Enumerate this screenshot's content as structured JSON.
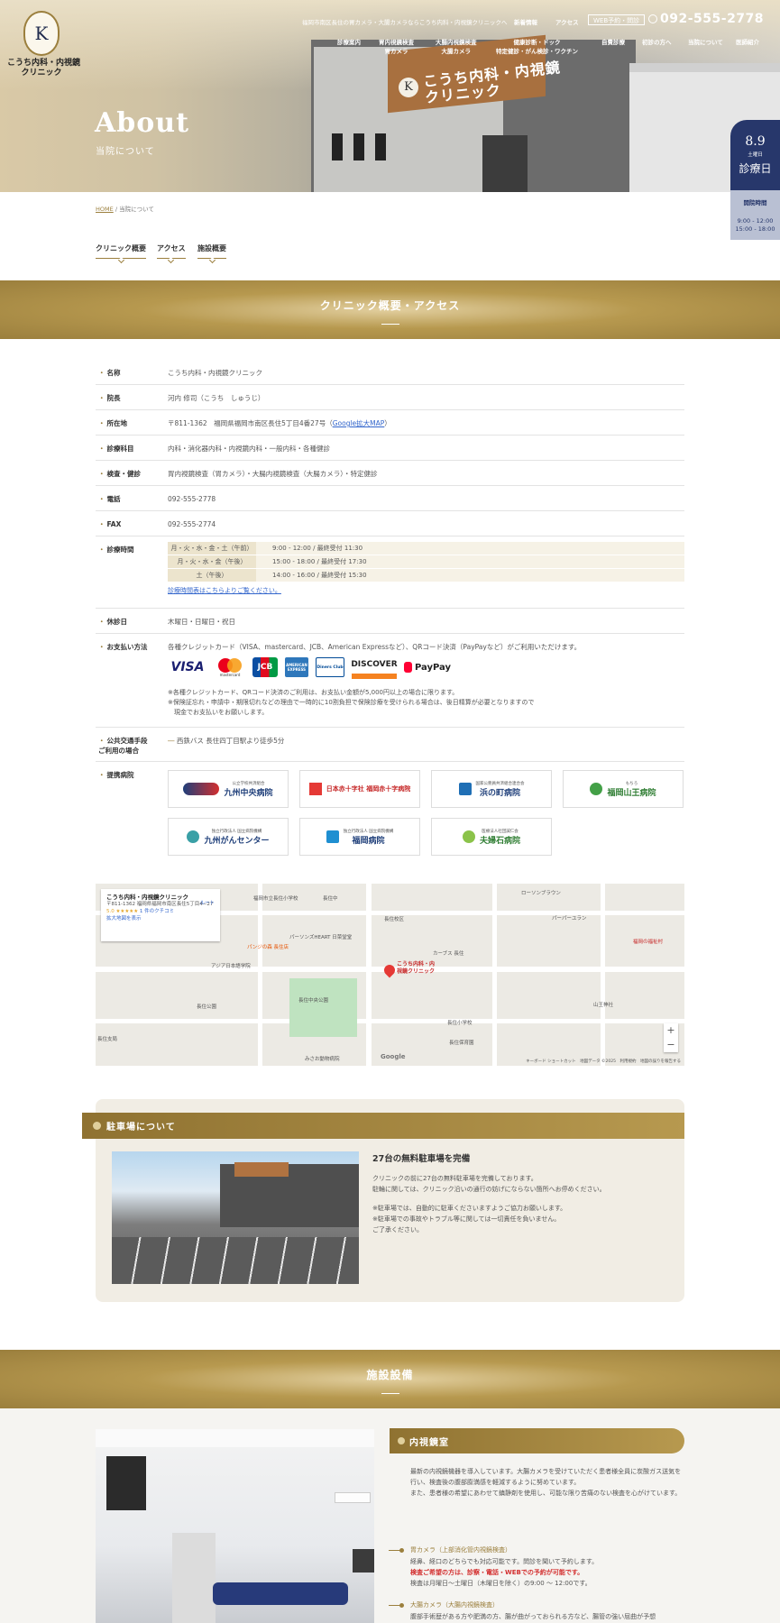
{
  "hero": {
    "logo_text": "こうち内科・内視鏡\nクリニック",
    "logo_letter": "K",
    "topbar_desc": "福岡市南区長住の胃カメラ・大腸カメラならこうち内科・内視鏡クリニックへ",
    "news": "新着情報",
    "access": "アクセス",
    "web_booking": "WEB予約・問診",
    "phone": "092-555-2778",
    "sign_text": "こうち内科・内視鏡\nクリニック",
    "title": "About",
    "subtitle": "当院について"
  },
  "gnav": [
    {
      "label": "診療案内"
    },
    {
      "label": "胃内視鏡検査\n胃カメラ"
    },
    {
      "label": "大腸内視鏡検査\n大腸カメラ"
    },
    {
      "label": "健康診断・ドック\n特定健診・がん検診・ワクチン"
    },
    {
      "label": "自費診療"
    },
    {
      "label": "初診の方へ"
    },
    {
      "label": "当院について"
    },
    {
      "label": "医師紹介"
    }
  ],
  "side": {
    "date": "8.9",
    "weekday": "土曜日",
    "status": "診療日",
    "hours_label": "開院時間",
    "hours": [
      "9:00 - 12:00",
      "15:00 - 18:00"
    ]
  },
  "breadcrumb": {
    "home": "HOME",
    "sep": "/",
    "current": "当院について"
  },
  "tabs": [
    {
      "label": "クリニック概要"
    },
    {
      "label": "アクセス"
    },
    {
      "label": "施設概要"
    }
  ],
  "overview": {
    "band_title": "クリニック概要・アクセス",
    "rows": {
      "name": {
        "label": "名称",
        "value": "こうち内科・内視鏡クリニック"
      },
      "director": {
        "label": "院長",
        "value": "河内 修司（こうち　しゅうじ）"
      },
      "address": {
        "label": "所在地",
        "value": "〒811-1362　福岡県福岡市南区長住5丁目4番27号（",
        "link": "Google拡大MAP",
        "tail": "）"
      },
      "depts": {
        "label": "診療科目",
        "value": "内科・消化器内科・内視鏡内科・一般内科・各種健診"
      },
      "exams": {
        "label": "検査・健診",
        "value": "胃内視鏡検査（胃カメラ）・大腸内視鏡検査（大腸カメラ）・特定健診"
      },
      "tel": {
        "label": "電話",
        "value": "092-555-2778"
      },
      "fax": {
        "label": "FAX",
        "value": "092-555-2774"
      },
      "hours": {
        "label": "診療時間",
        "items": [
          {
            "day": "月・火・水・金・土（午前）",
            "time": "9:00 - 12:00 / 最終受付 11:30"
          },
          {
            "day": "月・火・水・金（午後）",
            "time": "15:00 - 18:00 / 最終受付 17:30"
          },
          {
            "day": "土（午後）",
            "time": "14:00 - 16:00 / 最終受付 15:30"
          }
        ],
        "link": "診療時間表はこちらよりご覧ください。"
      },
      "closed": {
        "label": "休診日",
        "value": "木曜日・日曜日・祝日"
      },
      "payment": {
        "label": "お支払い方法",
        "value": "各種クレジットカード（VISA、mastercard、JCB、American Expressなど）、QRコード決済（PayPayなど）がご利用いただけます。",
        "logos": [
          "VISA",
          "mastercard",
          "JCB",
          "AMERICAN EXPRESS",
          "Diners Club",
          "DISCOVER",
          "PayPay"
        ],
        "notes": [
          "※各種クレジットカード、QRコード決済のご利用は、お支払い金額が5,000円以上の場合に限ります。",
          "※保険証忘れ・申請中・期限切れなどの理由で一時的に10割負担で保険診療を受けられる場合は、後日精算が必要となりますので",
          "　現金でお支払いをお願いします。"
        ]
      },
      "transport": {
        "label": "公共交通手段\nご利用の場合",
        "value": "西鉄バス 長住四丁目駅より徒歩5分"
      },
      "partners": {
        "label": "提携病院",
        "hospitals": [
          {
            "name": "九州中央病院",
            "sub": "公立学校共済組合"
          },
          {
            "name": "日本赤十字社 福岡赤十字病院",
            "sub": ""
          },
          {
            "name": "浜の町病院",
            "sub": "国家公務員共済組合連合会"
          },
          {
            "name": "福岡山王病院",
            "sub": "もちろ"
          },
          {
            "name": "九州がんセンター",
            "sub": "独立行政法人 国立病院機構"
          },
          {
            "name": "福岡病院",
            "sub": "独立行政法人 国立病院機構"
          },
          {
            "name": "夫婦石病院",
            "sub": "医療法人社団誠仁会"
          }
        ]
      }
    }
  },
  "map": {
    "place_name": "こうち内科・内視鏡クリニック",
    "place_addr": "〒811-1362 福岡県福岡市南区長住5丁目4−27",
    "rating": "5.0 ★★★★★",
    "reviews": "1 件のクチコミ",
    "enlarge": "拡大地図を表示",
    "route": "ルート",
    "pin_label": "こうち内科・内\n視鏡クリニック",
    "labels": [
      "福岡市立長住小学校",
      "長住校区",
      "長住中",
      "パーソンズHEART 日菜堂堂",
      "カーブス 長住",
      "福岡の福祉村",
      "パンジの森 長住店",
      "アジア日本語学院",
      "パーパーユラン",
      "長住中央公園",
      "長住公園",
      "山王神社",
      "長住保育園",
      "長住小学校",
      "長住支局",
      "ローソンブラウン",
      "みさお動物病院"
    ],
    "attr": "キーボード ショートカット　地図データ ©2025　利用規約　地図の誤りを報告する",
    "google": "Google"
  },
  "parking": {
    "title": "駐車場について",
    "heading": "27台の無料駐車場を完備",
    "p1": "クリニックの前に27台の無料駐車場を完備しております。\n駐輪に関しては、クリニック沿いの通行の妨げにならない箇所へお停めください。",
    "p2": "※駐車場では、自動的に駐車くださいますようご協力お願いします。\n※駐車場での事故やトラブル等に関しては一切責任を負いません。\nご了承ください。"
  },
  "facilities": {
    "band_title": "施設設備",
    "room_title": "内視鏡室",
    "room_text": "最新の内視鏡機器を導入しています。大腸カメラを受けていただく患者様全員に炭酸ガス送気を行い、検査後の腹部膨満感を軽減するように努めています。\nまた、患者様の希望にあわせて鎮静剤を使用し、可能な限り苦痛のない検査を心がけています。",
    "items": [
      {
        "heading": "胃カメラ（上部消化管内視鏡検査）",
        "text1": "経鼻、経口のどちらでも対応可能です。問診を聞いて予約します。",
        "text_red": "検査ご希望の方は、診察・電話・WEBでの予約が可能です。",
        "text2": "検査は月曜日〜土曜日（木曜日を除く）の9:00 〜 12:00です。"
      },
      {
        "heading": "大腸カメラ（大腸内視鏡検査）",
        "text1": "腹部手術歴がある方や肥満の方、腸が曲がっておられる方など、腸管の強い屈曲が予想"
      }
    ]
  },
  "colors": {
    "gold": "#9b7f3d",
    "navy": "#27376b",
    "link": "#3366cc"
  }
}
